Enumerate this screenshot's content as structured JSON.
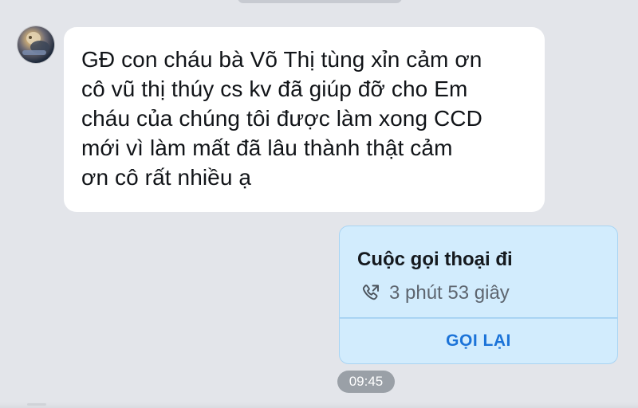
{
  "messages": {
    "incoming": {
      "lines": [
        "GĐ con cháu bà Võ Thị tùng xỉn cảm ơn",
        "cô vũ thị thúy cs kv đã giúp đỡ cho Em",
        "cháu của chúng tôi được làm xong CCD",
        "mới vì làm mất đã lâu thành thật cảm",
        "ơn cô rất nhiều ạ"
      ]
    },
    "call": {
      "title": "Cuộc gọi thoại đi",
      "duration": "3 phút 53 giây",
      "callback_label": "GỌI LẠI",
      "icon": "phone-outgoing-icon"
    },
    "timestamp": "09:45"
  },
  "colors": {
    "background": "#e3e5ea",
    "incoming_bubble": "#ffffff",
    "call_card": "#d2ecfd",
    "call_card_border": "#a9d4f3",
    "callback_text": "#1b73d8",
    "timestamp_pill": "#9aa0a7"
  }
}
